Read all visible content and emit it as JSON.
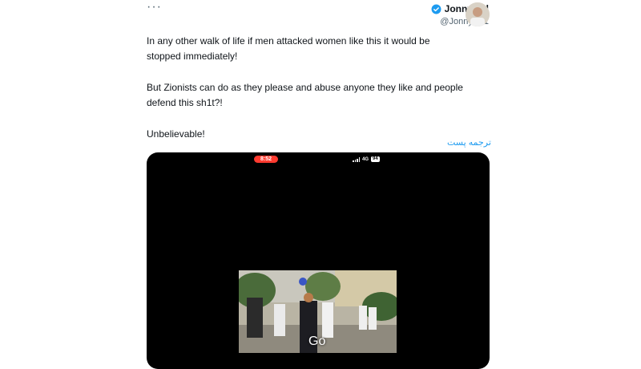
{
  "tweet": {
    "more_label": "···",
    "author_name": "JonnyUtd",
    "author_handle": "@JonnyFX1",
    "paragraphs": [
      "In any other walk of life if men attacked women like this it would be\nstopped immediately!",
      "But Zionists can do as they please and abuse anyone they like and people\ndefend this sh1t?!",
      "Unbelievable!"
    ],
    "translate_label": "ترجمه پست"
  },
  "media": {
    "status_time": "8:52",
    "network": "4G",
    "battery": "94",
    "video_caption": "Go"
  },
  "colors": {
    "link": "#1d9bf0",
    "verified": "#1d9bf0",
    "recording_pill": "#ff3b30"
  },
  "icons": {
    "verified": "verified-badge-icon",
    "more": "more-options-icon"
  }
}
